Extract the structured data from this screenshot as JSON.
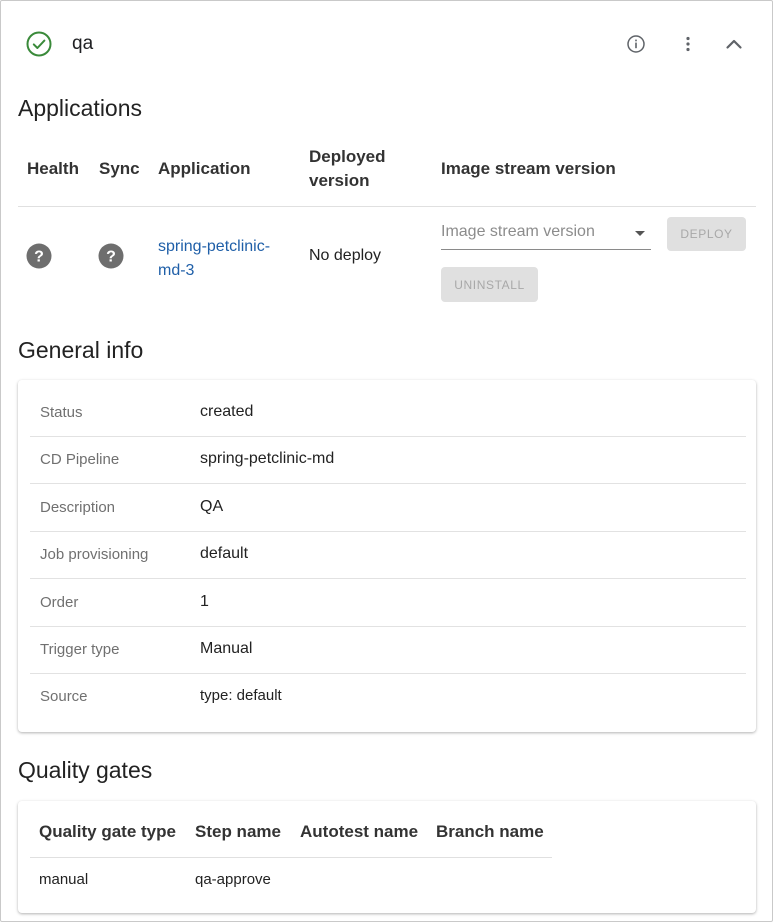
{
  "stage": {
    "name": "qa",
    "status_icon": "check-circle-icon",
    "status_color": "#3a8a3a"
  },
  "header_actions": [
    "info-icon",
    "more-vert-icon",
    "chevron-up-icon"
  ],
  "applications": {
    "title": "Applications",
    "columns": {
      "health": "Health",
      "sync": "Sync",
      "application": "Application",
      "deployed_version_line1": "Deployed",
      "deployed_version_line2": "version",
      "image_stream_version": "Image stream version"
    },
    "rows": [
      {
        "health_icon": "help-circle-icon",
        "sync_icon": "help-circle-icon",
        "application_line1": "spring-petclinic-",
        "application_line2": "md-3",
        "deployed_version": "No deploy",
        "image_stream_placeholder": "Image stream version",
        "deploy_label": "DEPLOY",
        "uninstall_label": "UNINSTALL"
      }
    ]
  },
  "general_info": {
    "title": "General info",
    "rows": [
      {
        "label": "Status",
        "value": "created"
      },
      {
        "label": "CD Pipeline",
        "value": "spring-petclinic-md"
      },
      {
        "label": "Description",
        "value": "QA"
      },
      {
        "label": "Job provisioning",
        "value": "default"
      },
      {
        "label": "Order",
        "value": "1"
      },
      {
        "label": "Trigger type",
        "value": "Manual"
      },
      {
        "label": "Source",
        "value": "type: default"
      }
    ]
  },
  "quality_gates": {
    "title": "Quality gates",
    "columns": {
      "type": "Quality gate type",
      "step": "Step name",
      "autotest": "Autotest name",
      "branch": "Branch name"
    },
    "rows": [
      {
        "type": "manual",
        "step": "qa-approve",
        "autotest": "",
        "branch": ""
      }
    ]
  },
  "colors": {
    "link": "#1f5fa8",
    "icon_grey": "#6e6e6e",
    "success_green": "#3a8a3a",
    "disabled_button_bg": "#e0e0e0"
  }
}
